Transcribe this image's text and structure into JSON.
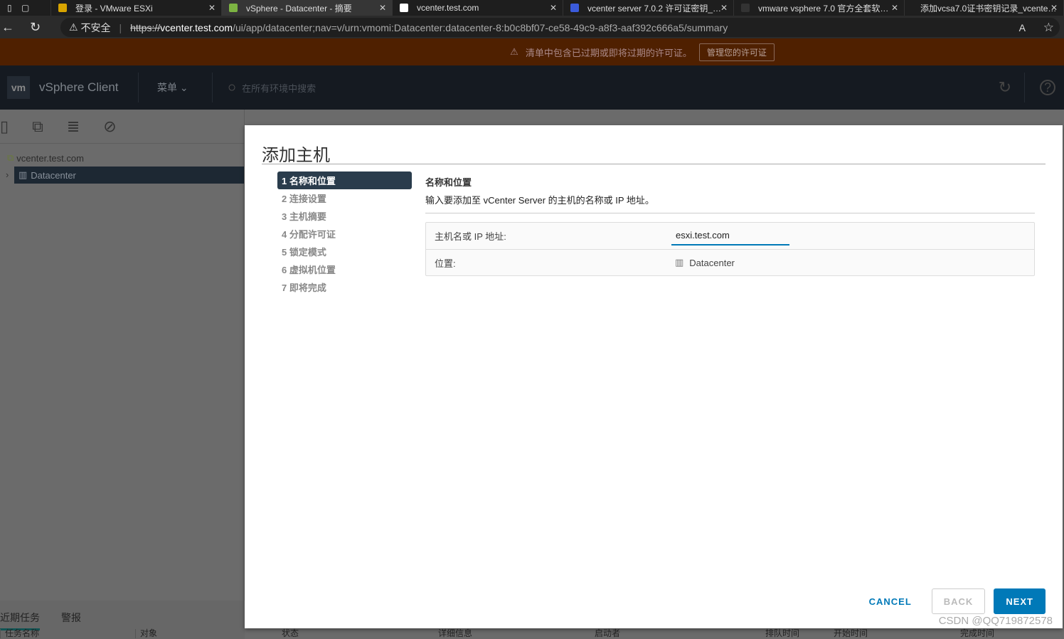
{
  "browser": {
    "tabs": [
      {
        "title": "登录 - VMware ESXi",
        "fav": "#d8a400",
        "active": false
      },
      {
        "title": "vSphere - Datacenter - 摘要",
        "fav": "#7cb342",
        "active": true
      },
      {
        "title": "vcenter.test.com",
        "fav": "#ffffff",
        "active": false
      },
      {
        "title": "vcenter server 7.0.2 许可证密钥_…",
        "fav": "#3b5bdb",
        "active": false
      },
      {
        "title": "vmware vsphere 7.0 官方全套软…",
        "fav": "#333333",
        "active": false
      },
      {
        "title": "添加vcsa7.0证书密钥记录_vcente…",
        "fav": "#e8432a",
        "active": false
      }
    ],
    "security_label": "不安全",
    "url_scheme": "https://",
    "url_host": "vcenter.test.com",
    "url_path": "/ui/app/datacenter;nav=v/urn:vmomi:Datacenter:datacenter-8:b0c8bf07-ce58-49c9-a8f3-aaf392c666a5/summary"
  },
  "banner": {
    "message": "清单中包含已过期或即将过期的许可证。",
    "button": "管理您的许可证"
  },
  "header": {
    "logo": "vm",
    "title": "vSphere Client",
    "menu": "菜单",
    "search_placeholder": "在所有环境中搜索"
  },
  "sidebar": {
    "tree": [
      {
        "label": "vcenter.test.com"
      },
      {
        "label": "Datacenter"
      }
    ]
  },
  "bottom": {
    "tabs": [
      "近期任务",
      "警报"
    ],
    "columns": [
      "任务名称",
      "对象",
      "状态",
      "详细信息",
      "启动者",
      "排队时间",
      "开始时间",
      "完成时间"
    ]
  },
  "dialog": {
    "title": "添加主机",
    "steps": [
      "1 名称和位置",
      "2 连接设置",
      "3 主机摘要",
      "4 分配许可证",
      "5 锁定模式",
      "6 虚拟机位置",
      "7 即将完成"
    ],
    "section_title": "名称和位置",
    "section_desc": "输入要添加至 vCenter Server 的主机的名称或 IP 地址。",
    "host_label": "主机名或 IP 地址:",
    "host_value": "esxi.test.com",
    "location_label": "位置:",
    "location_value": "Datacenter",
    "cancel": "CANCEL",
    "back": "BACK",
    "next": "NEXT"
  },
  "watermark": "CSDN @QQ719872578",
  "colors": {
    "accent": "#0079b8",
    "active_step": "#2a3c4c"
  }
}
